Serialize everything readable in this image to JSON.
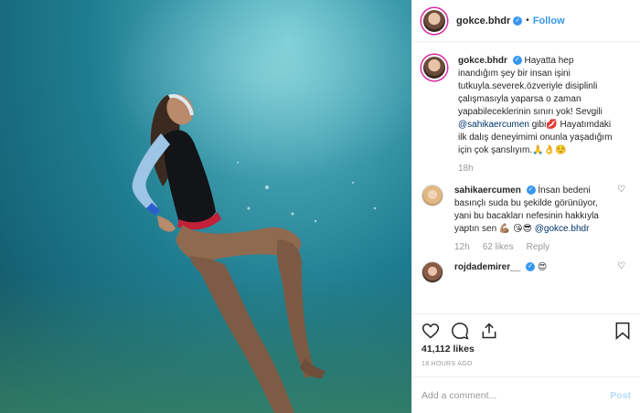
{
  "header": {
    "username": "gokce.bhdr",
    "separator": "•",
    "follow_label": "Follow"
  },
  "caption": {
    "username": "gokce.bhdr",
    "text_1": "Hayatta hep inandığım şey bir insan işini tutkuyla.severek.özveriyle disiplinli çalışmasıyla yaparsa o zaman yapabileceklerinin sınırı yok! Sevgili",
    "mention": "@sahikaercumen",
    "text_2": "gibi💋 Hayatımdaki ilk dalış deneyimimi onunla yaşadığım için çok şanslıyım.🙏👌☺️",
    "time": "18h"
  },
  "comments": [
    {
      "username": "sahikaercumen",
      "text": "İnsan bedeni basınçlı suda bu şekilde görünüyor, yani bu bacakları nefesinin hakkıyla yaptın sen 💪🏽 😘😎",
      "mention": "@gokce.bhdr",
      "time": "12h",
      "likes": "62 likes",
      "reply_label": "Reply"
    },
    {
      "username": "rojdademirer__",
      "text": "😍"
    }
  ],
  "icons": {
    "verified": "✓",
    "comment_heart": "♡"
  },
  "footer": {
    "likes": "41,112 likes",
    "timestamp": "18 HOURS AGO",
    "comment_placeholder": "Add a comment...",
    "post_label": "Post"
  },
  "colors": {
    "accent": "#3897f0",
    "water_top": "#6fc6cf",
    "water_bottom": "#124e5c"
  }
}
